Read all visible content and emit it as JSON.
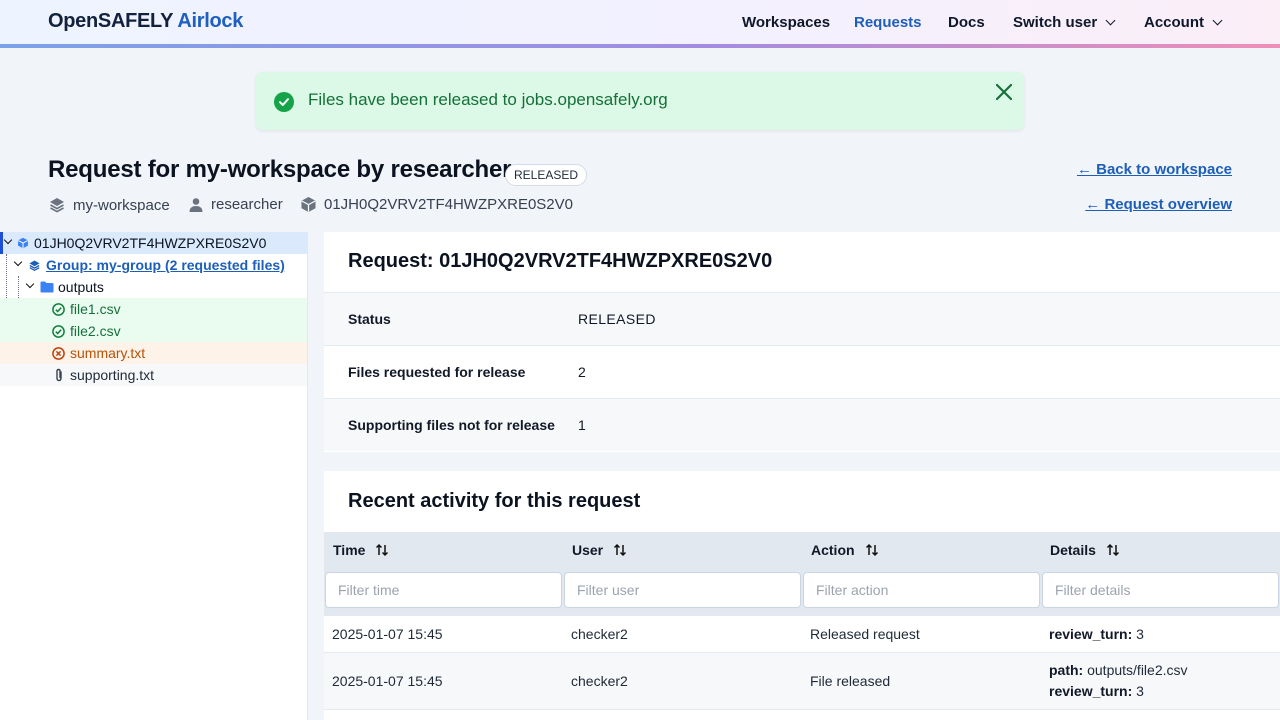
{
  "brand": {
    "part1": "OpenSAFELY",
    "part2": "Airlock"
  },
  "nav": {
    "workspaces": "Workspaces",
    "requests": "Requests",
    "docs": "Docs",
    "switch_user": "Switch user",
    "account": "Account"
  },
  "alert": {
    "message": "Files have been released to jobs.opensafely.org"
  },
  "page": {
    "title": "Request for my-workspace by researcher",
    "status_badge": "RELEASED",
    "meta_workspace": "my-workspace",
    "meta_user": "researcher",
    "meta_request_id": "01JH0Q2VRV2TF4HWZPXRE0S2V0",
    "back_to_workspace": "← Back to workspace",
    "request_overview": "← Request overview"
  },
  "tree": {
    "root": "01JH0Q2VRV2TF4HWZPXRE0S2V0",
    "group": "Group: my-group (2 requested files)",
    "folder": "outputs",
    "files": [
      {
        "name": "file1.csv",
        "state": "approved"
      },
      {
        "name": "file2.csv",
        "state": "approved"
      },
      {
        "name": "summary.txt",
        "state": "rejected"
      },
      {
        "name": "supporting.txt",
        "state": "supporting"
      }
    ]
  },
  "request_panel": {
    "title": "Request: 01JH0Q2VRV2TF4HWZPXRE0S2V0",
    "rows": [
      {
        "key": "Status",
        "value": "RELEASED"
      },
      {
        "key": "Files requested for release",
        "value": "2"
      },
      {
        "key": "Supporting files not for release",
        "value": "1"
      }
    ]
  },
  "activity": {
    "title": "Recent activity for this request",
    "columns": [
      "Time",
      "User",
      "Action",
      "Details"
    ],
    "filters": [
      "Filter time",
      "Filter user",
      "Filter action",
      "Filter details"
    ],
    "rows": [
      {
        "time": "2025-01-07 15:45",
        "user": "checker2",
        "action": "Released request",
        "details": [
          {
            "k": "review_turn:",
            "v": "3"
          }
        ]
      },
      {
        "time": "2025-01-07 15:45",
        "user": "checker2",
        "action": "File released",
        "details": [
          {
            "k": "path:",
            "v": "outputs/file2.csv"
          },
          {
            "k": "review_turn:",
            "v": "3"
          }
        ]
      }
    ]
  },
  "colors": {
    "accent": "#1d5fb8",
    "success": "#15a34a",
    "rejected": "#b45309",
    "header_gradient_end": "#ee8fb7"
  }
}
